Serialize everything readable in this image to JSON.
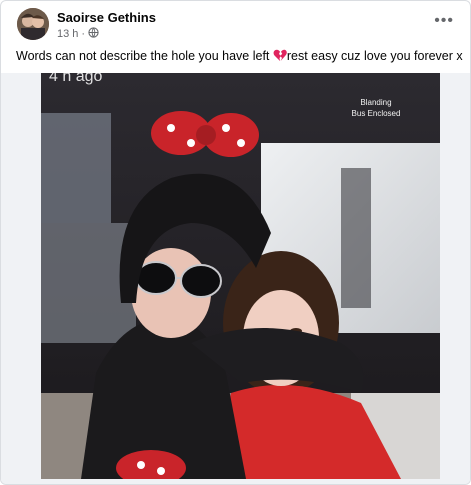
{
  "post": {
    "author": "Saoirse Gethins",
    "time": "13 h",
    "separator": "·",
    "privacy_icon": "globe-icon",
    "more_icon": "more-options-icon",
    "caption_before": "Words can not describe the hole you have left ",
    "caption_emoji": "broken-heart-icon",
    "caption_after": "rest easy cuz love you forever x"
  },
  "photo": {
    "overlay_time": "4 h ago",
    "overlay_sign_line1": "Blanding",
    "overlay_sign_line2": "Bus Enclosed"
  },
  "colors": {
    "author": "#050505",
    "meta": "#65676b",
    "heart": "#e0245e",
    "sweater": "#d42a2a"
  }
}
